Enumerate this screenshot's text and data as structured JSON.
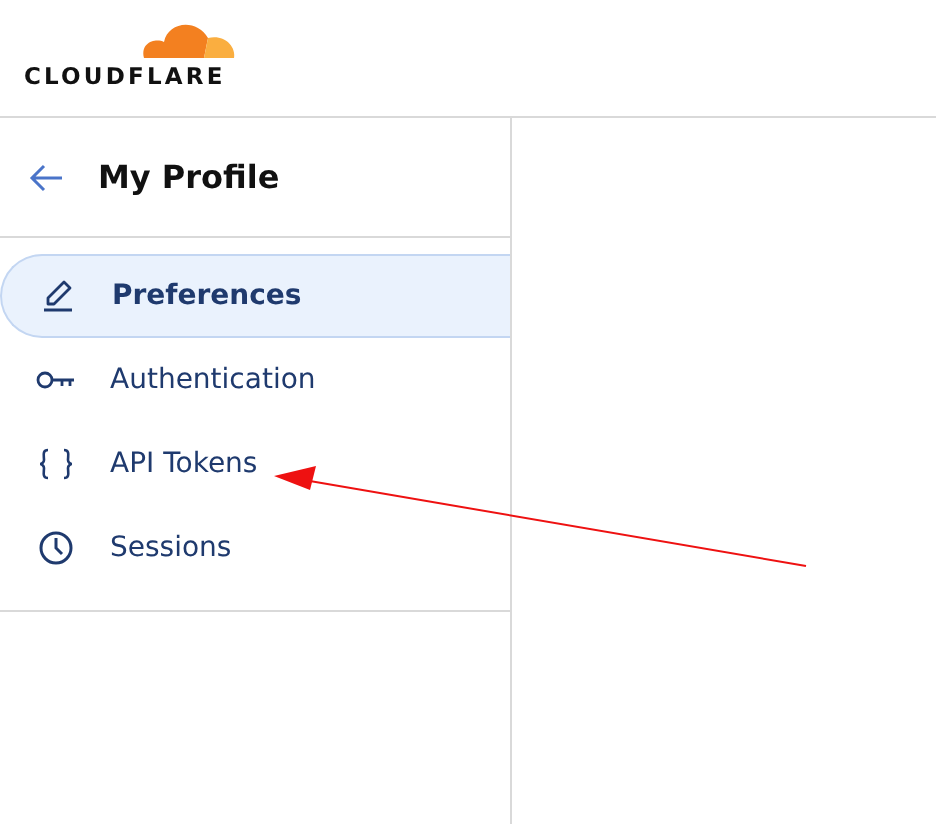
{
  "logo": {
    "text": "CLOUDFLARE"
  },
  "sidebar": {
    "title": "My Profile",
    "items": [
      {
        "label": "Preferences",
        "selected": true
      },
      {
        "label": "Authentication",
        "selected": false
      },
      {
        "label": "API Tokens",
        "selected": false
      },
      {
        "label": "Sessions",
        "selected": false
      }
    ]
  }
}
